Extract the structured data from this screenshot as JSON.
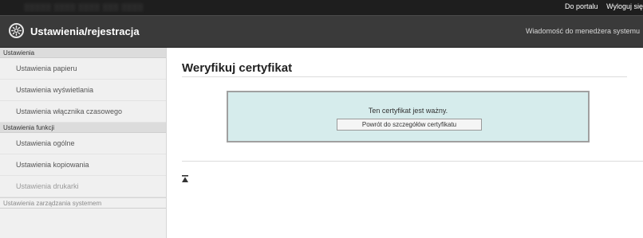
{
  "topbar": {
    "device_name": "░░░░░   ░░░░ ░░░░ ░░░ ░░░░",
    "portal_link": "Do portalu",
    "logout_link": "Wyloguj się"
  },
  "header": {
    "title": "Ustawienia/rejestracja",
    "message_link": "Wiadomość do menedżera systemu"
  },
  "sidebar": {
    "section1": {
      "heading": "Ustawienia",
      "items": [
        {
          "label": "Ustawienia papieru"
        },
        {
          "label": "Ustawienia wyświetlania"
        },
        {
          "label": "Ustawienia włącznika czasowego"
        }
      ]
    },
    "section2": {
      "heading": "Ustawienia funkcji",
      "items": [
        {
          "label": "Ustawienia ogólne"
        },
        {
          "label": "Ustawienia kopiowania"
        },
        {
          "label": "Ustawienia drukarki"
        }
      ]
    },
    "section3": {
      "heading": "Ustawienia zarządzania systemem"
    }
  },
  "main": {
    "page_title": "Weryfikuj certyfikat",
    "status_text": "Ten certyfikat jest ważny.",
    "back_button": "Powrót do szczegółów certyfikatu"
  }
}
